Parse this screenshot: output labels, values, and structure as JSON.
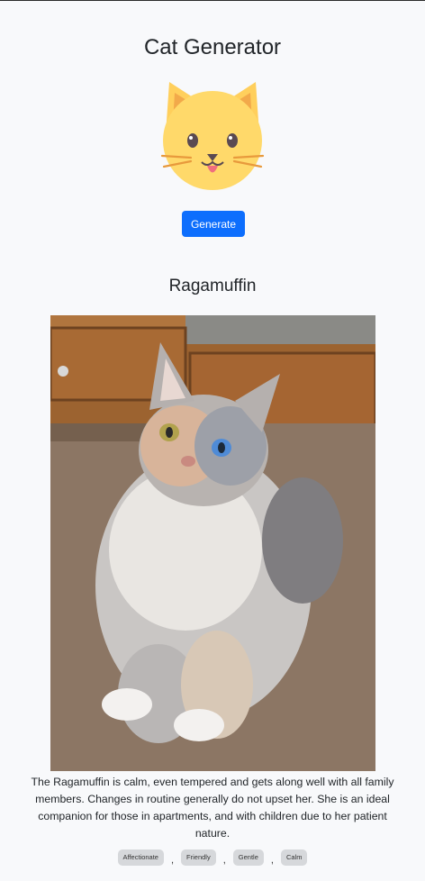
{
  "page": {
    "title": "Cat Generator",
    "logo_icon": "cat-face-icon",
    "generate_button_label": "Generate"
  },
  "result": {
    "breed_name": "Ragamuffin",
    "photo_alt": "Ragamuffin cat photo",
    "description": "The Ragamuffin is calm, even tempered and gets along well with all family members. Changes in routine generally do not upset her. She is an ideal companion for those in apartments, and with children due to her patient nature.",
    "temperament": [
      "Affectionate",
      "Friendly",
      "Gentle",
      "Calm"
    ],
    "separator": ","
  },
  "colors": {
    "primary_button": "#0d6efd",
    "page_background": "#f8f9fb",
    "tag_background": "#d6d8db"
  }
}
